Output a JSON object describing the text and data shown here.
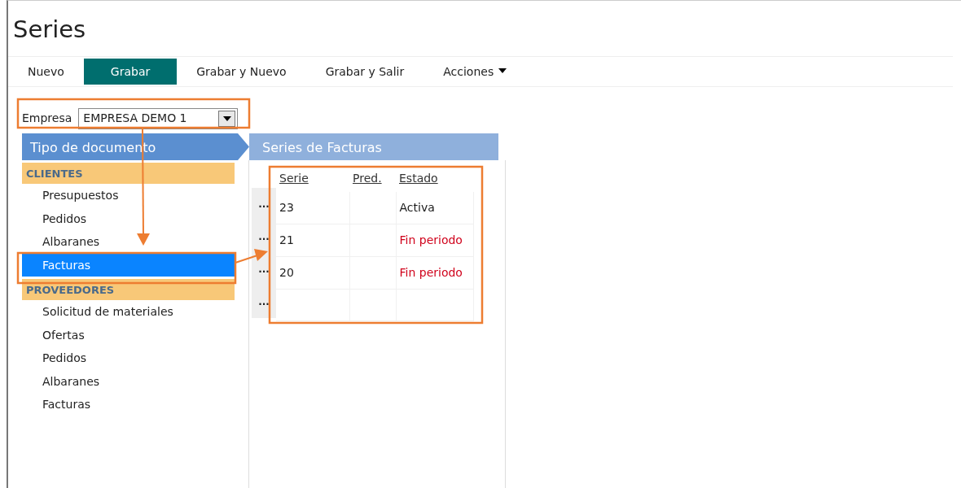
{
  "title": "Series",
  "toolbar": [
    {
      "label": "Nuevo",
      "selected": false
    },
    {
      "label": "Grabar",
      "selected": true
    },
    {
      "label": "Grabar y Nuevo",
      "selected": false
    },
    {
      "label": "Grabar y Salir",
      "selected": false
    },
    {
      "label": "Acciones",
      "selected": false,
      "kind": "dropdown"
    }
  ],
  "empresa": {
    "label": "Empresa",
    "value": "EMPRESA DEMO 1"
  },
  "left_header": "Tipo de documento",
  "right_header": "Series de Facturas",
  "groups": [
    {
      "label": "CLIENTES",
      "items": [
        {
          "label": "Presupuestos",
          "selected": false
        },
        {
          "label": "Pedidos",
          "selected": false
        },
        {
          "label": "Albaranes",
          "selected": false
        },
        {
          "label": "Facturas",
          "selected": true
        }
      ]
    },
    {
      "label": "PROVEEDORES",
      "items": [
        {
          "label": "Solicitud de materiales",
          "selected": false
        },
        {
          "label": "Ofertas",
          "selected": false
        },
        {
          "label": "Pedidos",
          "selected": false
        },
        {
          "label": "Albaranes",
          "selected": false
        },
        {
          "label": "Facturas",
          "selected": false
        }
      ]
    }
  ],
  "table": {
    "columns": [
      "Serie",
      "Pred.",
      "Estado"
    ],
    "rows": [
      {
        "button": "...",
        "serie": "23",
        "estado": "Activa",
        "color": "#1a1a1a"
      },
      {
        "button": "...",
        "serie": "21",
        "estado": "Fin periodo",
        "color": "#d0021b"
      },
      {
        "button": "...",
        "serie": "20",
        "estado": "Fin periodo",
        "color": "#d0021b"
      },
      {
        "button": "..."
      }
    ]
  }
}
